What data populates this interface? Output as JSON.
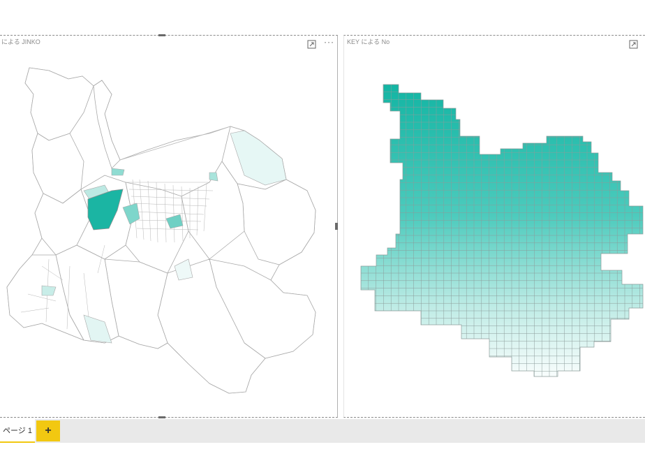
{
  "visuals": {
    "left": {
      "title": "による JINKO",
      "focus_icon": "focus-mode-icon",
      "more_icon": "more-options-icon",
      "more_glyph": "···"
    },
    "right": {
      "title": "KEY による No",
      "focus_icon": "focus-mode-icon"
    }
  },
  "pages": {
    "tabs": [
      {
        "label": "ページ 1",
        "active": true
      }
    ],
    "add_label": "+"
  },
  "colors": {
    "accent": "#f2c811",
    "map_dark": "#1bb5a3",
    "map_light": "#ffffff",
    "map_outline": "#9a9a9a"
  }
}
